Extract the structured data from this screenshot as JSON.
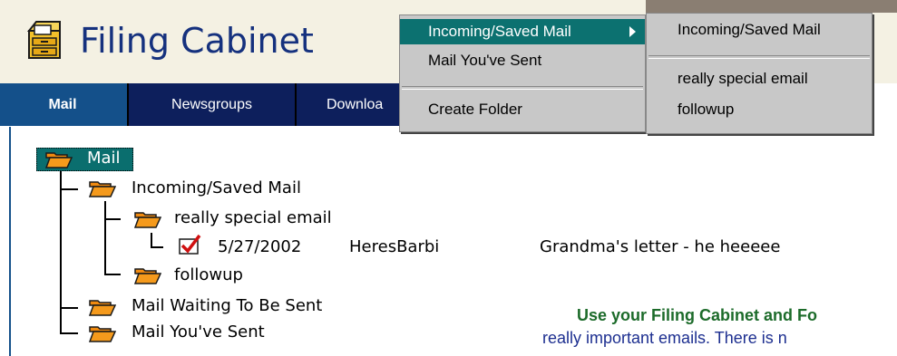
{
  "app": {
    "title": "Filing Cabinet",
    "icon": "filing-cabinet-icon"
  },
  "tabs": [
    {
      "label": "Mail",
      "active": true
    },
    {
      "label": "Newsgroups",
      "active": false
    },
    {
      "label": "Downloa",
      "active": false
    }
  ],
  "tree": {
    "root": {
      "label": "Mail",
      "selected": true
    },
    "incoming": {
      "label": "Incoming/Saved Mail"
    },
    "special": {
      "label": "really special email"
    },
    "message": {
      "date": "5/27/2002",
      "from": "HeresBarbi",
      "subject": "Grandma's letter - he heeeee",
      "icon": "checked-message-icon"
    },
    "followup": {
      "label": "followup"
    },
    "waiting": {
      "label": "Mail Waiting To Be Sent"
    },
    "sent": {
      "label": "Mail You've Sent"
    }
  },
  "promo": {
    "title": "Use your Filing Cabinet and Fo",
    "body": "really important emails.  There is n"
  },
  "context_menu": {
    "items": [
      {
        "label": "Incoming/Saved Mail",
        "highlighted": true,
        "has_submenu": true
      },
      {
        "label": "Mail You've Sent"
      },
      {
        "label": "Create Folder"
      }
    ]
  },
  "submenu": {
    "items": [
      {
        "label": "Incoming/Saved Mail"
      },
      {
        "label": "really special email"
      },
      {
        "label": "followup"
      }
    ]
  },
  "colors": {
    "brand": "#15317e",
    "tab_bg": "#14508a",
    "highlight": "#0c7170",
    "folder": "#f08a10"
  }
}
